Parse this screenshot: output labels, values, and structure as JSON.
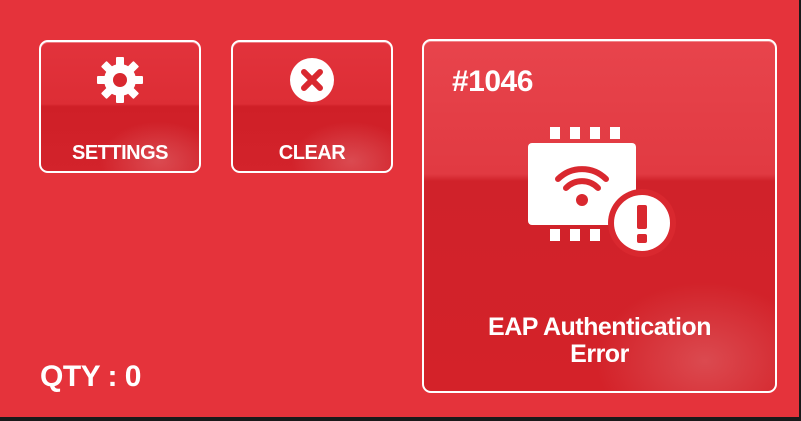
{
  "toolbar": {
    "settings_label": "SETTINGS",
    "settings_icon": "gear-icon",
    "clear_label": "CLEAR",
    "clear_icon": "close-circle-icon"
  },
  "error": {
    "code": "#1046",
    "icon": "wifi-chip-error-icon",
    "title_line1": "EAP Authentication",
    "title_line2": "Error"
  },
  "status": {
    "qty_label": "QTY : 0"
  },
  "colors": {
    "background": "#e5333b",
    "tile_border": "#ffffff",
    "text": "#ffffff"
  }
}
